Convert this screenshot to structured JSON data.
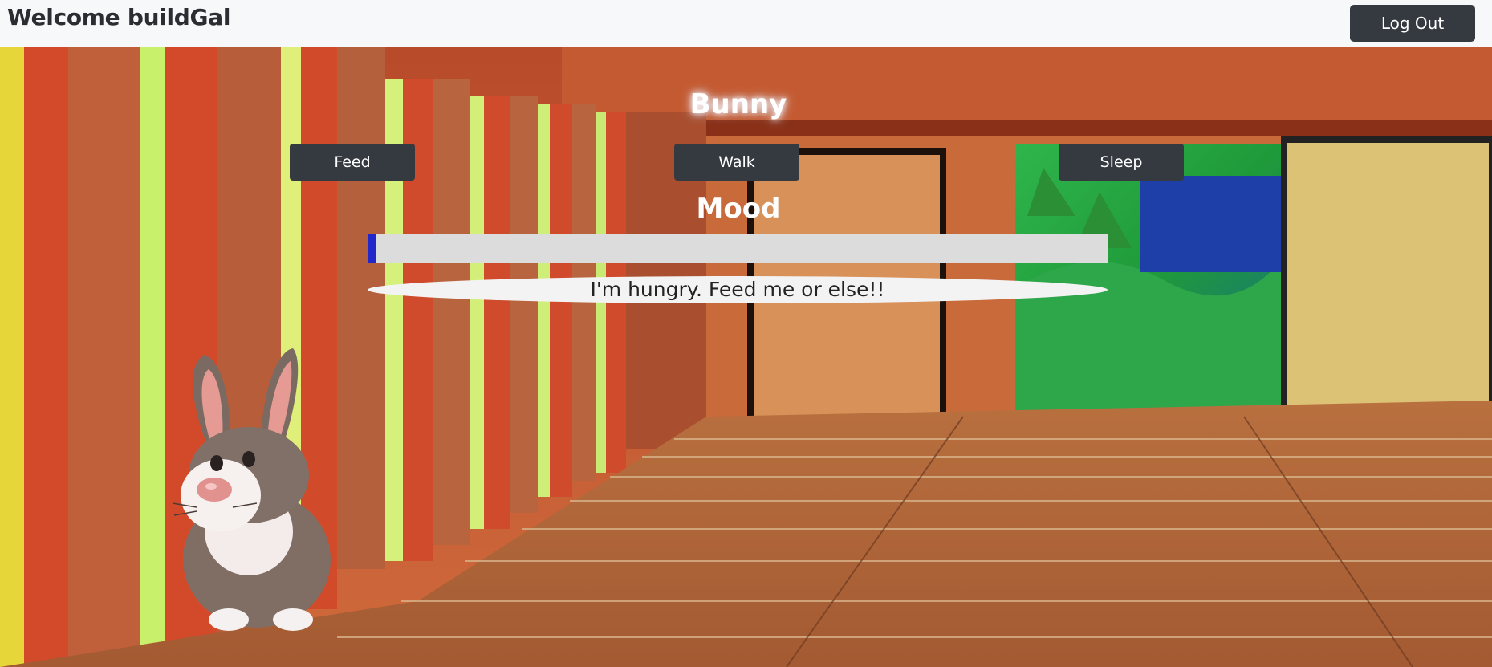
{
  "header": {
    "welcome_text": "Welcome buildGal",
    "logout_label": "Log Out"
  },
  "pet": {
    "name": "Bunny",
    "image": "bunny-icon"
  },
  "actions": {
    "feed_label": "Feed",
    "walk_label": "Walk",
    "sleep_label": "Sleep"
  },
  "mood": {
    "title": "Mood",
    "level_percent": 1,
    "message": "I'm hungry. Feed me or else!!",
    "bar_color": "#2127c9"
  },
  "colors": {
    "button_bg": "#353a41",
    "navbar_bg": "#f7f8f9"
  }
}
